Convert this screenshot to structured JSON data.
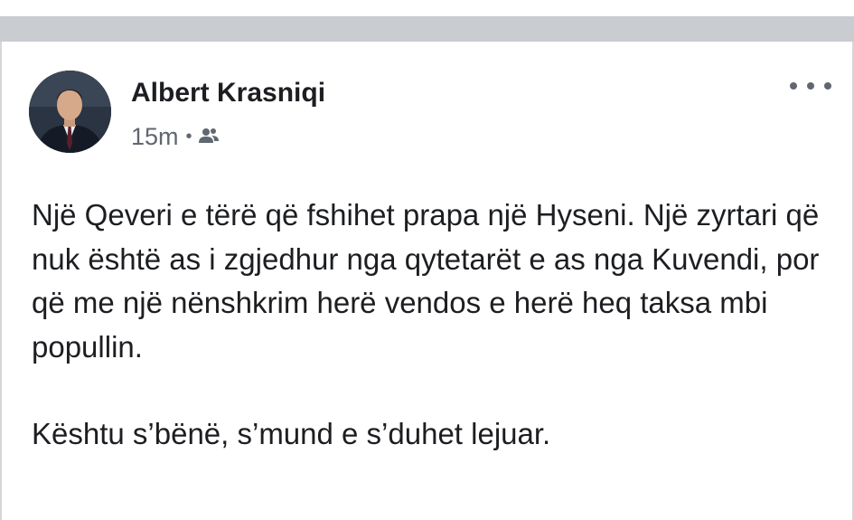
{
  "post": {
    "author": "Albert Krasniqi",
    "timestamp": "15m",
    "separator": "•",
    "privacy_icon": "friends-icon",
    "more_icon": "more-options-icon",
    "paragraphs": [
      "Një Qeveri e tërë që fshihet prapa një Hyseni. Një zyrtari që nuk është as i zgjedhur nga qytetarët e as nga Kuvendi, por që me një nënshkrim herë vendos e herë heq taksa mbi popullin.",
      "Kështu s’bënë, s’mund e s’duhet lejuar."
    ]
  },
  "colors": {
    "divider": "#c9ccd1",
    "text": "#1c1e21",
    "secondary_text": "#606770"
  }
}
